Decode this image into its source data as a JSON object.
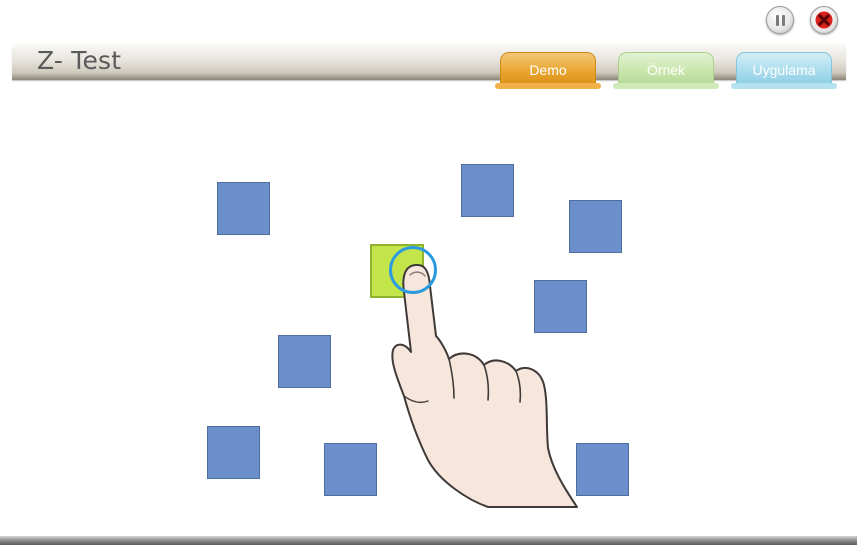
{
  "header": {
    "title": "Z- Test"
  },
  "controls": {
    "pause_icon": "pause-icon",
    "close_icon": "close-icon"
  },
  "tabs": [
    {
      "label": "Demo",
      "color": "#e9a733",
      "active": true
    },
    {
      "label": "Örnek",
      "color": "#c8e5ab",
      "active": false
    },
    {
      "label": "Uygulama",
      "color": "#a8dbec",
      "active": false
    }
  ],
  "stimulus": {
    "square_count": 9,
    "highlighted_count": 1,
    "square_color": "#6a8fcb",
    "highlight_color": "#c4e54a",
    "tap_ring_color": "#2b9be0"
  }
}
